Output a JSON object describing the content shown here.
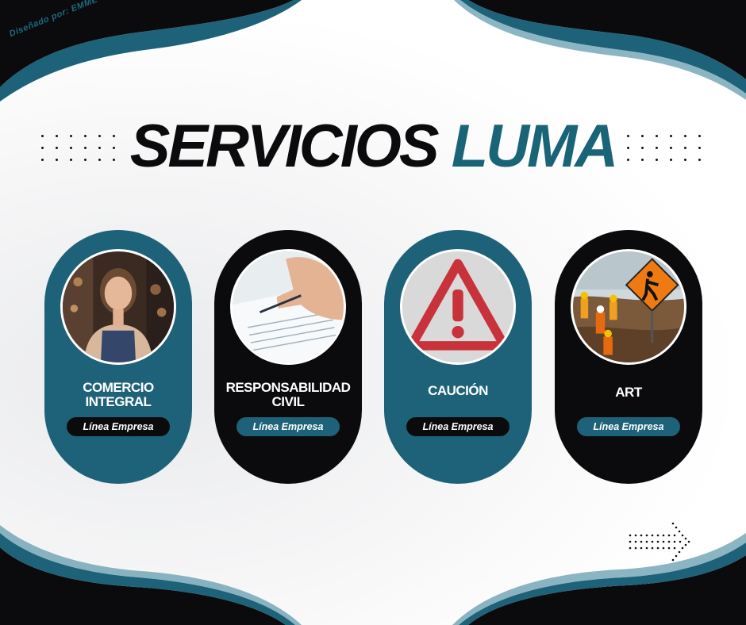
{
  "credit": "Diseñado por: EMME CREATIONS",
  "title": {
    "word1": "SERVICIOS",
    "word2": "LUMA"
  },
  "colors": {
    "teal": "#1d6278",
    "black": "#0b0b0d",
    "accent_text": "#1a6478"
  },
  "cards": [
    {
      "title_line1": "COMERCIO",
      "title_line2": "INTEGRAL",
      "badge": "Línea Empresa",
      "image": "shop-owner-photo"
    },
    {
      "title_line1": "RESPONSABILIDAD",
      "title_line2": "CIVIL",
      "badge": "Línea Empresa",
      "image": "signing-document-photo"
    },
    {
      "title_line1": "CAUCIÓN",
      "title_line2": "",
      "badge": "Línea Empresa",
      "image": "warning-sign-photo"
    },
    {
      "title_line1": "ART",
      "title_line2": "",
      "badge": "Línea Empresa",
      "image": "construction-workers-photo"
    }
  ],
  "decor": {
    "dots_icon": "dot-grid",
    "arrow_icon": "dotted-arrow-right-icon"
  }
}
